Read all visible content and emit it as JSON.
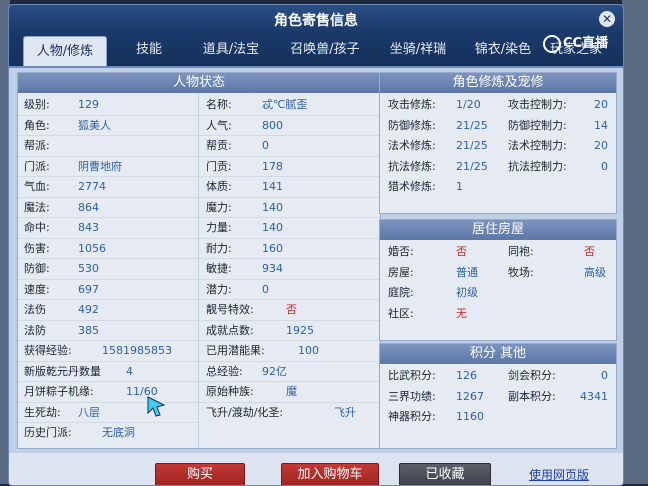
{
  "window": {
    "title": "角色寄售信息"
  },
  "tabs": [
    {
      "label": "人物/修炼",
      "active": true
    },
    {
      "label": "技能"
    },
    {
      "label": "道具/法宝"
    },
    {
      "label": "召唤兽/孩子"
    },
    {
      "label": "坐骑/祥瑞"
    },
    {
      "label": "锦衣/染色"
    },
    {
      "label": "玩家之家"
    }
  ],
  "overlay_logo": "CC直播",
  "status": {
    "title": "人物状态",
    "left": [
      {
        "k": "级别:",
        "v": "129"
      },
      {
        "k": "角色:",
        "v": "狐美人"
      },
      {
        "k": "帮派:",
        "v": ""
      },
      {
        "k": "门派:",
        "v": "阴曹地府"
      },
      {
        "k": "气血:",
        "v": "2774"
      },
      {
        "k": "魔法:",
        "v": "864"
      },
      {
        "k": "命中:",
        "v": "843"
      },
      {
        "k": "伤害:",
        "v": "1056"
      },
      {
        "k": "防御:",
        "v": "530"
      },
      {
        "k": "速度:",
        "v": "697"
      },
      {
        "k": "法伤",
        "v": "492"
      },
      {
        "k": "法防",
        "v": "385"
      },
      {
        "k": "获得经验:",
        "v": "1581985853"
      },
      {
        "k": "新版乾元丹数量",
        "v": "4"
      },
      {
        "k": "月饼粽子机缘:",
        "v": "11/60"
      },
      {
        "k": "生死劫:",
        "v": "八层"
      },
      {
        "k": "历史门派:",
        "v": "无底洞"
      }
    ],
    "right": [
      {
        "k": "名称:",
        "v": "忒℃腻歪"
      },
      {
        "k": "人气:",
        "v": "800"
      },
      {
        "k": "帮贡:",
        "v": "0"
      },
      {
        "k": "门贡:",
        "v": "178"
      },
      {
        "k": "体质:",
        "v": "141"
      },
      {
        "k": "魔力:",
        "v": "140"
      },
      {
        "k": "力量:",
        "v": "140"
      },
      {
        "k": "耐力:",
        "v": "160"
      },
      {
        "k": "敏捷:",
        "v": "934"
      },
      {
        "k": "潜力:",
        "v": "0"
      },
      {
        "k": "靓号特效:",
        "v": "否"
      },
      {
        "k": "成就点数:",
        "v": "1925"
      },
      {
        "k": "已用潜能果:",
        "v": "100"
      },
      {
        "k": "总经验:",
        "v": "92亿"
      },
      {
        "k": "原始种族:",
        "v": "魔"
      },
      {
        "k": "飞升/渡劫/化圣:",
        "v": "飞升"
      }
    ]
  },
  "cultivation": {
    "title": "角色修炼及宠修",
    "rows": [
      {
        "k1": "攻击修炼:",
        "v1": "1/20",
        "k2": "攻击控制力:",
        "v2": "20"
      },
      {
        "k1": "防御修炼:",
        "v1": "21/25",
        "k2": "防御控制力:",
        "v2": "14"
      },
      {
        "k1": "法术修炼:",
        "v1": "21/25",
        "k2": "法术控制力:",
        "v2": "20"
      },
      {
        "k1": "抗法修炼:",
        "v1": "21/25",
        "k2": "抗法控制力:",
        "v2": "0"
      },
      {
        "k1": "猎术修炼:",
        "v1": "1",
        "k2": "",
        "v2": ""
      }
    ]
  },
  "house": {
    "title": "居住房屋",
    "rows": [
      {
        "k1": "婚否:",
        "v1": "否",
        "k2": "同袍:",
        "v2": "否"
      },
      {
        "k1": "房屋:",
        "v1": "普通",
        "k2": "牧场:",
        "v2": "高级"
      },
      {
        "k1": "庭院:",
        "v1": "初级",
        "k2": "",
        "v2": ""
      },
      {
        "k1": "社区:",
        "v1": "无",
        "k2": "",
        "v2": ""
      }
    ]
  },
  "points": {
    "title": "积分 其他",
    "rows": [
      {
        "k1": "比武积分:",
        "v1": "126",
        "k2": "剑会积分:",
        "v2": "0"
      },
      {
        "k1": "三界功绩:",
        "v1": "1267",
        "k2": "副本积分:",
        "v2": "4341"
      },
      {
        "k1": "神器积分:",
        "v1": "1160",
        "k2": "",
        "v2": ""
      }
    ]
  },
  "actions": {
    "buy": "购买",
    "add_cart": "加入购物车",
    "favorited": "已收藏",
    "web_link": "使用网页版"
  }
}
